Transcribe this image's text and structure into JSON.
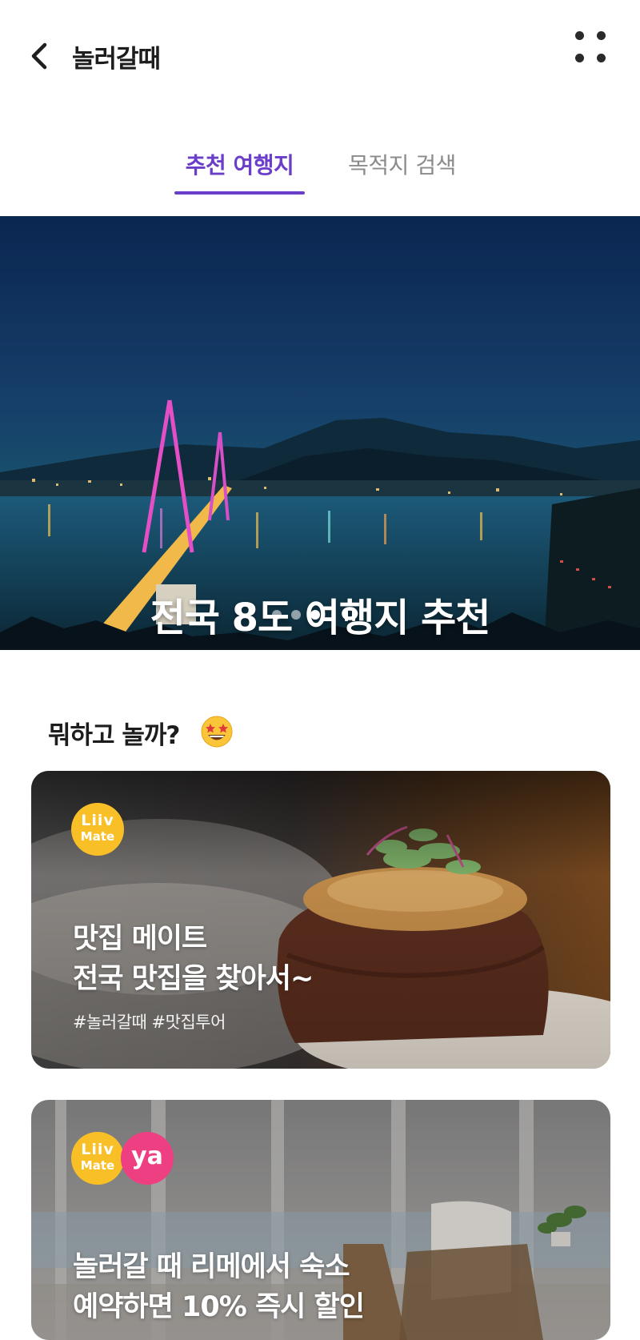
{
  "header": {
    "title": "놀러갈때"
  },
  "tabs": [
    {
      "label": "추천 여행지",
      "active": true
    },
    {
      "label": "목적지 검색",
      "active": false
    }
  ],
  "banner": {
    "title": "전국 8도 여행지 추천",
    "slide_count": 3,
    "active_slide": 3
  },
  "section": {
    "title": "뭐하고 놀까?",
    "emoji": "🤩"
  },
  "cards": [
    {
      "badges": [
        {
          "line1": "Liiv",
          "line2": "Mate"
        }
      ],
      "title_line1": "맛집 메이트",
      "title_line2": "전국 맛집을 찾아서~",
      "tags": "#놀러갈때 #맛집투어"
    },
    {
      "badges": [
        {
          "line1": "Liiv",
          "line2": "Mate"
        },
        {
          "text": "ya"
        }
      ],
      "title_line1": "놀러갈 때 리메에서 숙소",
      "title_line2": "예약하면 10% 즉시 할인"
    }
  ],
  "colors": {
    "accent": "#6a3ec9",
    "liiv_yellow": "#f8bf27",
    "ya_pink": "#ee3f83"
  }
}
